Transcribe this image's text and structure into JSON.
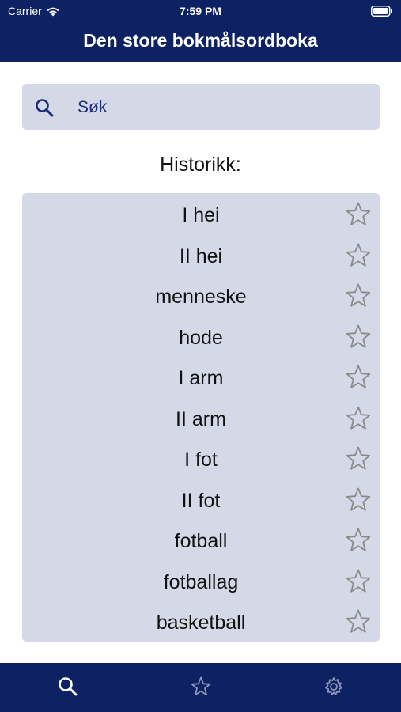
{
  "status": {
    "carrier": "Carrier",
    "time": "7:59 PM"
  },
  "nav": {
    "title": "Den store bokmålsordboka"
  },
  "search": {
    "placeholder": "Søk",
    "icon": "search-icon"
  },
  "history": {
    "title": "Historikk:",
    "items": [
      {
        "word": "I hei",
        "favorite": false
      },
      {
        "word": "II hei",
        "favorite": false
      },
      {
        "word": "menneske",
        "favorite": false
      },
      {
        "word": "hode",
        "favorite": false
      },
      {
        "word": "I arm",
        "favorite": false
      },
      {
        "word": "II arm",
        "favorite": false
      },
      {
        "word": "I fot",
        "favorite": false
      },
      {
        "word": "II fot",
        "favorite": false
      },
      {
        "word": "fotball",
        "favorite": false
      },
      {
        "word": "fotballag",
        "favorite": false
      },
      {
        "word": "basketball",
        "favorite": false
      }
    ]
  },
  "tabbar": {
    "tabs": [
      {
        "name": "search",
        "icon": "search-icon",
        "active": true
      },
      {
        "name": "favorites",
        "icon": "star-icon",
        "active": false
      },
      {
        "name": "settings",
        "icon": "gear-icon",
        "active": false
      }
    ]
  },
  "colors": {
    "navy": "#0d2163",
    "panel": "#d5d8e6",
    "accent": "#1a2f7a",
    "star": "#8a8a8a"
  }
}
